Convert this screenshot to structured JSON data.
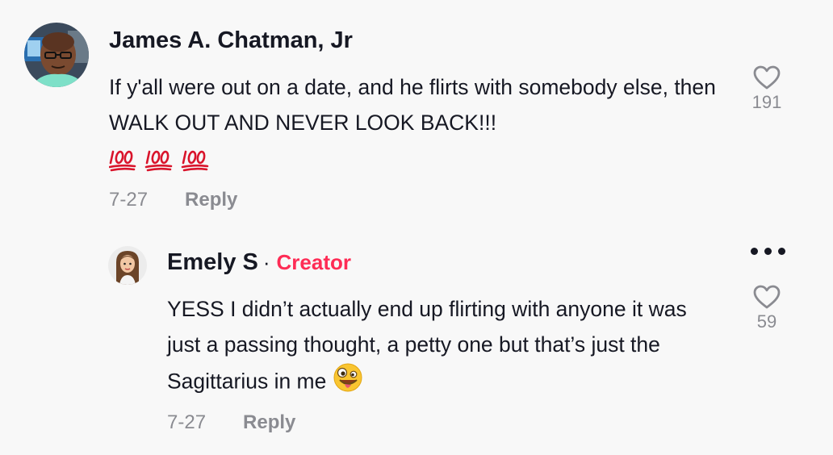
{
  "comments": [
    {
      "author": "James A. Chatman, Jr",
      "text": "If y'all were out on a date, and he flirts with somebody else, then WALK OUT AND NEVER LOOK BACK!!!",
      "emojis": "💯 💯 💯",
      "date": "7-27",
      "reply_label": "Reply",
      "likes": "191"
    }
  ],
  "reply": {
    "author": "Emely S",
    "separator": "·",
    "badge": "Creator",
    "text": "YESS I didn’t actually end up flirting with anyone it was just a passing thought, a petty one but that’s just the Sagittarius in me",
    "date": "7-27",
    "reply_label": "Reply",
    "likes": "59",
    "more_icon": "ellipsis-icon"
  },
  "colors": {
    "background": "#f8f8f8",
    "text": "#161823",
    "muted": "#8a8b91",
    "creator_badge": "#fe2c55"
  }
}
